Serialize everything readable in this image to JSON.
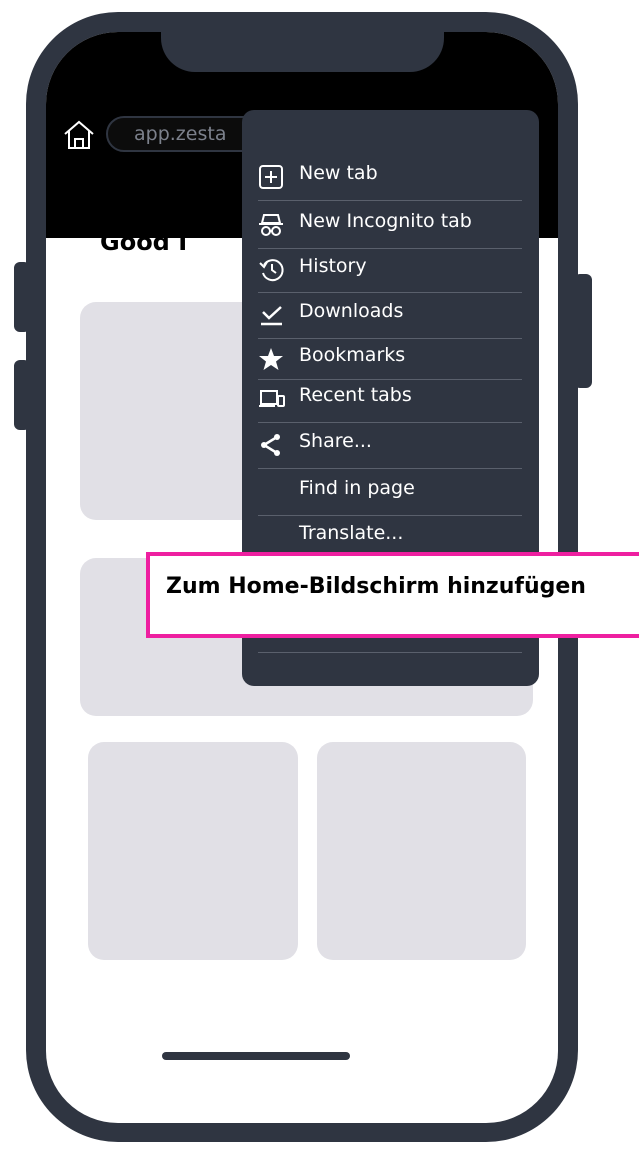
{
  "browser": {
    "url_text": "app.zesta"
  },
  "page": {
    "greeting_text": "Good I"
  },
  "menu": {
    "items": [
      {
        "label": "New tab",
        "icon": "new-tab-icon"
      },
      {
        "label": "New Incognito tab",
        "icon": "incognito-icon"
      },
      {
        "label": "History",
        "icon": "history-icon"
      },
      {
        "label": "Downloads",
        "icon": "download-check-icon"
      },
      {
        "label": "Bookmarks",
        "icon": "star-icon"
      },
      {
        "label": "Recent tabs",
        "icon": "devices-icon"
      },
      {
        "label": "Share...",
        "icon": "share-icon"
      },
      {
        "label": "Find in page",
        "icon": ""
      },
      {
        "label": "Translate...",
        "icon": ""
      }
    ]
  },
  "callout": {
    "text": "Zum Home-Bildschirm hinzufügen",
    "border_color": "#ee1fa0"
  },
  "colors": {
    "device_frame": "#2f3541",
    "menu_bg": "#2f3541",
    "placeholder_card": "#e1e0e6",
    "highlight": "#ee1fa0"
  }
}
